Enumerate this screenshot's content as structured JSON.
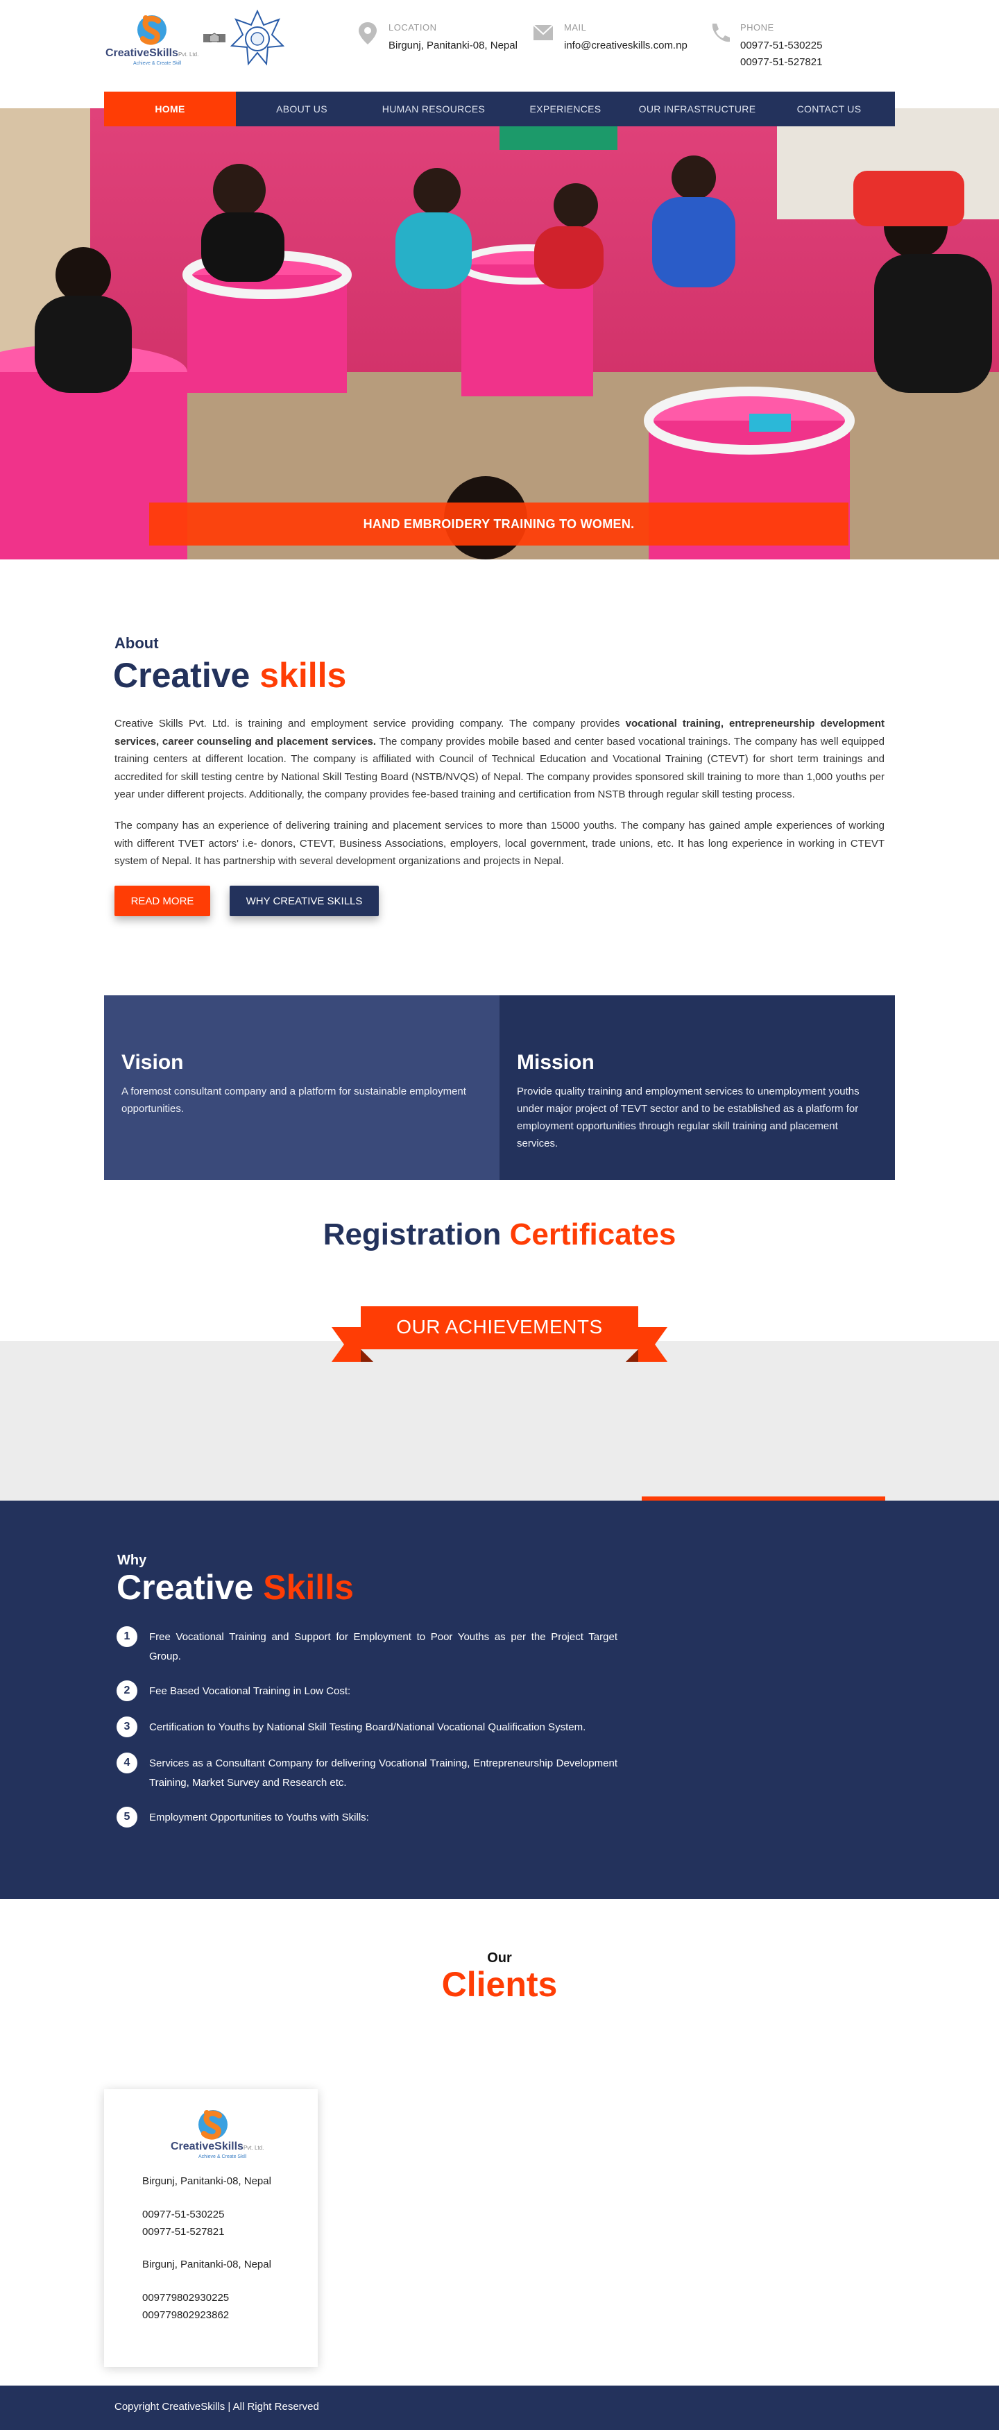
{
  "header": {
    "logo": {
      "brand": "CreativeSkills",
      "brand_suffix": "Pvt. Ltd.",
      "tagline": "Achieve & Create Skill"
    },
    "location": {
      "label": "LOCATION",
      "value": "Birgunj, Panitanki-08, Nepal"
    },
    "mail": {
      "label": "MAIL",
      "value": "info@creativeskills.com.np"
    },
    "phone": {
      "label": "PHONE",
      "values": [
        "00977-51-530225",
        "00977-51-527821"
      ]
    }
  },
  "nav": {
    "items": [
      {
        "label": "HOME",
        "active": true
      },
      {
        "label": "ABOUT US"
      },
      {
        "label": "HUMAN RESOURCES"
      },
      {
        "label": "EXPERIENCES"
      },
      {
        "label": "OUR INFRASTRUCTURE"
      },
      {
        "label": "CONTACT US"
      }
    ]
  },
  "hero": {
    "caption": "HAND EMBROIDERY TRAINING TO WOMEN.",
    "next_icon": "chevron-right-icon"
  },
  "about": {
    "eyebrow": "About",
    "title_main": "Creative",
    "title_accent": "skills",
    "p1_pre": "Creative Skills Pvt. Ltd. is training and employment service providing company. The company provides ",
    "p1_bold": "vocational training, entrepreneurship development services, career counseling and placement services.",
    "p1_post": " The company provides mobile based and center based vocational trainings. The company has well equipped training centers at different location. The company is affiliated with Council of Technical Education and Vocational Training (CTEVT) for short term trainings and accredited for skill testing centre by National Skill Testing Board (NSTB/NVQS) of Nepal. The company provides sponsored skill training to more than 1,000 youths per year under different projects. Additionally, the company provides fee-based training and certification from NSTB through regular skill testing process.",
    "p2": "The company has an experience of delivering training and placement services to more than 15000 youths. The company has gained ample experiences of working with different TVET actors' i.e- donors, CTEVT, Business Associations, employers, local government, trade unions, etc. It has long experience in working in CTEVT system of Nepal. It has partnership with several development organizations and projects in Nepal.",
    "read_more": "READ MORE",
    "why_button": "WHY CREATIVE SKILLS"
  },
  "vision": {
    "title": "Vision",
    "text": "A foremost consultant company and a platform for sustainable employment opportunities."
  },
  "mission": {
    "title": "Mission",
    "text": "Provide quality training and employment services to unemployment youths under major project of TEVT sector and to be established as a platform for employment opportunities through regular skill training and placement services."
  },
  "registration": {
    "title_main": "Registration",
    "title_accent": "Certificates",
    "ribbon": "OUR ACHIEVEMENTS"
  },
  "why": {
    "eyebrow": "Why",
    "title_main": "Creative",
    "title_accent": "Skills",
    "items": [
      {
        "num": "1",
        "text": "Free Vocational Training and Support for Employment to Poor Youths as per the Project Target Group."
      },
      {
        "num": "2",
        "text": "Fee Based Vocational Training in Low Cost:"
      },
      {
        "num": "3",
        "text": "Certification to Youths by National Skill Testing Board/National Vocational Qualification System."
      },
      {
        "num": "4",
        "text": "Services as a Consultant Company for delivering Vocational Training, Entrepreneurship Development Training, Market Survey and Research etc."
      },
      {
        "num": "5",
        "text": "Employment Opportunities to Youths with Skills:"
      }
    ]
  },
  "clients": {
    "eyebrow": "Our",
    "title": "Clients"
  },
  "card": {
    "address1": "Birgunj, Panitanki-08, Nepal",
    "phone1": "00977-51-530225",
    "phone2": "00977-51-527821",
    "address2": "Birgunj, Panitanki-08, Nepal",
    "mobile1": "009779802930225",
    "mobile2": "009779802923862"
  },
  "footer": {
    "copyright": "Copyright CreativeSkills | All Right Reserved"
  },
  "colors": {
    "navy": "#23325c",
    "navy_light": "#3a4a7a",
    "accent": "#ff3d05",
    "band_gray": "#ececec"
  }
}
